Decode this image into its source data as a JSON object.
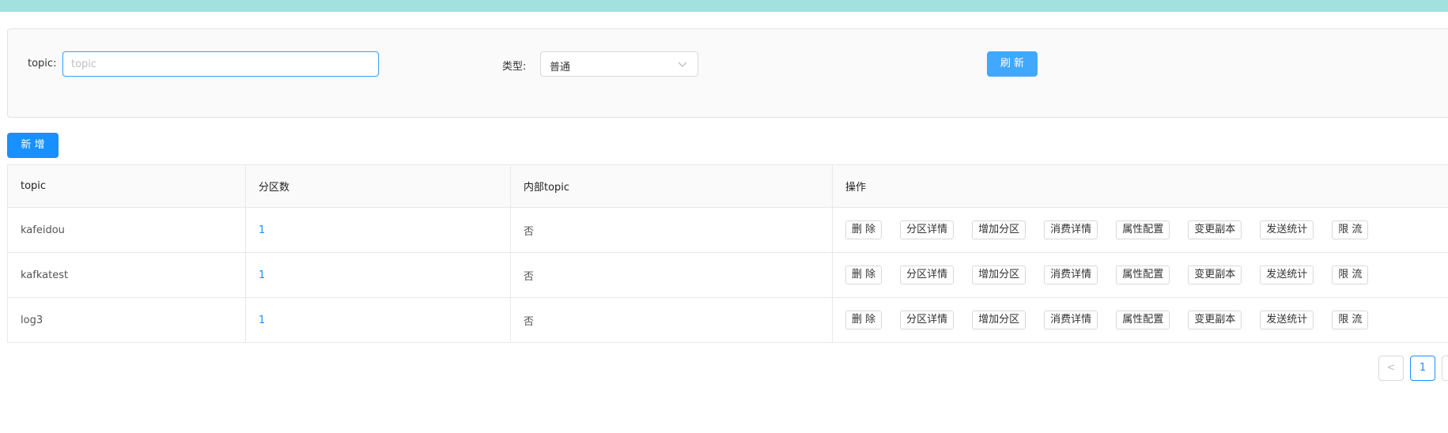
{
  "filter": {
    "topic_label": "topic",
    "topic_placeholder": "topic",
    "topic_value": "",
    "type_label": "类型",
    "type_value": "普通",
    "refresh_label": "刷 新"
  },
  "toolbar": {
    "add_label": "新 增"
  },
  "table": {
    "headers": [
      "topic",
      "分区数",
      "内部topic",
      "操作"
    ],
    "actions": [
      "删 除",
      "分区详情",
      "增加分区",
      "消费详情",
      "属性配置",
      "变更副本",
      "发送统计",
      "限 流"
    ],
    "rows": [
      {
        "topic": "kafeidou",
        "partitions": "1",
        "internal": "否"
      },
      {
        "topic": "kafkatest",
        "partitions": "1",
        "internal": "否"
      },
      {
        "topic": "log3",
        "partitions": "1",
        "internal": "否"
      }
    ]
  },
  "pagination": {
    "prev": "<",
    "current": "1"
  },
  "colors": {
    "topbar": "#a2e1e0",
    "primary": "#1890ff",
    "refresh": "#40a9ff"
  },
  "icons": {
    "select_arrow": "chevron-down-icon"
  }
}
